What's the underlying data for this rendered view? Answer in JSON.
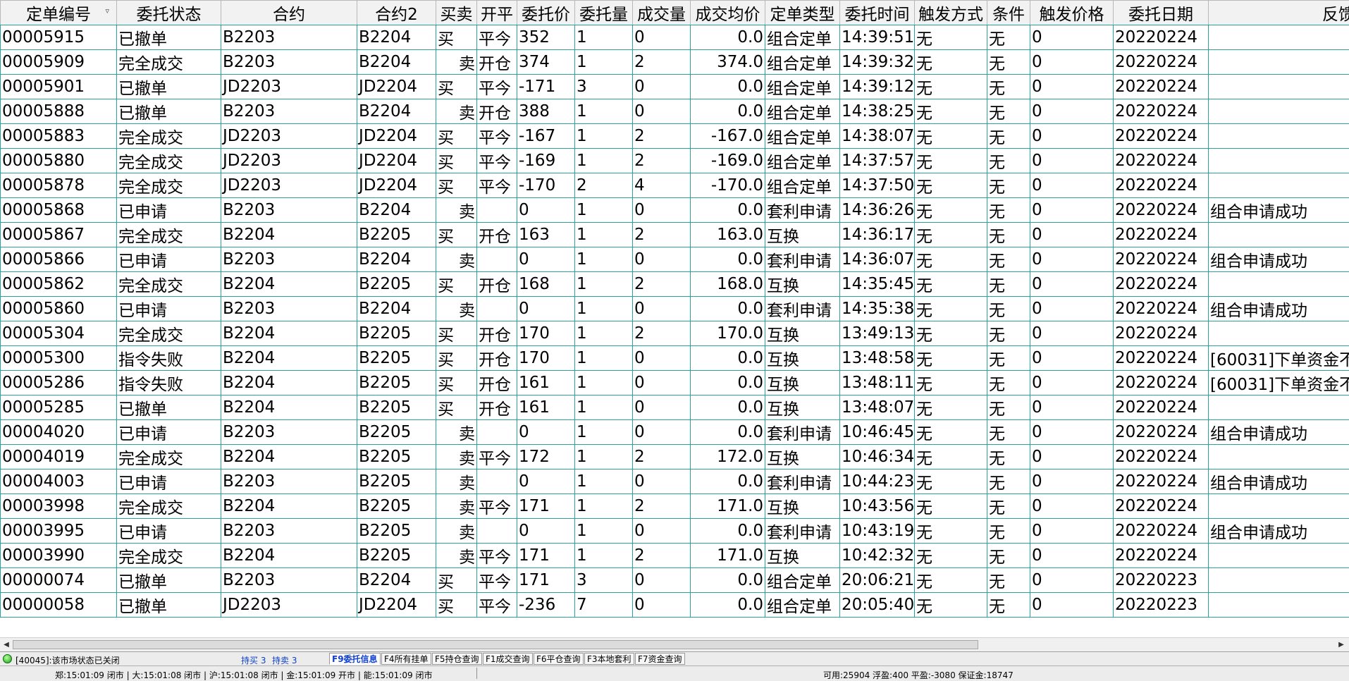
{
  "columns": [
    "定单编号",
    "委托状态",
    "合约",
    "合约2",
    "买卖",
    "开平",
    "委托价",
    "委托量",
    "成交量",
    "成交均价",
    "定单类型",
    "委托时间",
    "触发方式",
    "条件",
    "触发价格",
    "委托日期",
    "反馈"
  ],
  "rows": [
    {
      "id": "00005915",
      "status": "已撤单",
      "status_color": "olive",
      "c1": "B2203",
      "c2": "B2204",
      "bs": "买",
      "bs_color": "red",
      "oc": "平今",
      "oc_color": "green",
      "price": "352",
      "qty": "1",
      "filled": "0",
      "filled_color": "black",
      "avg": "0.0",
      "type": "组合定单",
      "time": "14:39:51",
      "trig": "无",
      "cond": "无",
      "tprice": "0",
      "date": "20220224",
      "fb": ""
    },
    {
      "id": "00005909",
      "status": "完全成交",
      "status_color": "green",
      "c1": "B2203",
      "c2": "B2204",
      "bs": "卖",
      "bs_color": "green",
      "oc": "开仓",
      "oc_color": "red",
      "price": "374",
      "qty": "1",
      "filled": "2",
      "filled_color": "red",
      "avg": "374.0",
      "type": "组合定单",
      "time": "14:39:32",
      "trig": "无",
      "cond": "无",
      "tprice": "0",
      "date": "20220224",
      "fb": ""
    },
    {
      "id": "00005901",
      "status": "已撤单",
      "status_color": "olive",
      "c1": "JD2203",
      "c2": "JD2204",
      "bs": "买",
      "bs_color": "red",
      "oc": "平今",
      "oc_color": "green",
      "price": "-171",
      "qty": "3",
      "filled": "0",
      "filled_color": "black",
      "avg": "0.0",
      "type": "组合定单",
      "time": "14:39:12",
      "trig": "无",
      "cond": "无",
      "tprice": "0",
      "date": "20220224",
      "fb": ""
    },
    {
      "id": "00005888",
      "status": "已撤单",
      "status_color": "olive",
      "c1": "B2203",
      "c2": "B2204",
      "bs": "卖",
      "bs_color": "green",
      "oc": "开仓",
      "oc_color": "red",
      "price": "388",
      "qty": "1",
      "filled": "0",
      "filled_color": "black",
      "avg": "0.0",
      "type": "组合定单",
      "time": "14:38:25",
      "trig": "无",
      "cond": "无",
      "tprice": "0",
      "date": "20220224",
      "fb": ""
    },
    {
      "id": "00005883",
      "status": "完全成交",
      "status_color": "green",
      "c1": "JD2203",
      "c2": "JD2204",
      "bs": "买",
      "bs_color": "red",
      "oc": "平今",
      "oc_color": "green",
      "price": "-167",
      "qty": "1",
      "filled": "2",
      "filled_color": "red",
      "avg": "-167.0",
      "type": "组合定单",
      "time": "14:38:07",
      "trig": "无",
      "cond": "无",
      "tprice": "0",
      "date": "20220224",
      "fb": ""
    },
    {
      "id": "00005880",
      "status": "完全成交",
      "status_color": "green",
      "c1": "JD2203",
      "c2": "JD2204",
      "bs": "买",
      "bs_color": "red",
      "oc": "平今",
      "oc_color": "green",
      "price": "-169",
      "qty": "1",
      "filled": "2",
      "filled_color": "red",
      "avg": "-169.0",
      "type": "组合定单",
      "time": "14:37:57",
      "trig": "无",
      "cond": "无",
      "tprice": "0",
      "date": "20220224",
      "fb": ""
    },
    {
      "id": "00005878",
      "status": "完全成交",
      "status_color": "green",
      "c1": "JD2203",
      "c2": "JD2204",
      "bs": "买",
      "bs_color": "red",
      "oc": "平今",
      "oc_color": "green",
      "price": "-170",
      "qty": "2",
      "filled": "4",
      "filled_color": "red",
      "avg": "-170.0",
      "type": "组合定单",
      "time": "14:37:50",
      "trig": "无",
      "cond": "无",
      "tprice": "0",
      "date": "20220224",
      "fb": ""
    },
    {
      "id": "00005868",
      "status": "已申请",
      "status_color": "black",
      "c1": "B2203",
      "c2": "B2204",
      "bs": "卖",
      "bs_color": "green",
      "oc": "",
      "oc_color": "black",
      "price": "0",
      "qty": "1",
      "filled": "0",
      "filled_color": "black",
      "avg": "0.0",
      "type": "套利申请",
      "time": "14:36:26",
      "trig": "无",
      "cond": "无",
      "tprice": "0",
      "date": "20220224",
      "fb": "组合申请成功"
    },
    {
      "id": "00005867",
      "status": "完全成交",
      "status_color": "green",
      "c1": "B2204",
      "c2": "B2205",
      "bs": "买",
      "bs_color": "red",
      "oc": "开仓",
      "oc_color": "red",
      "price": "163",
      "qty": "1",
      "filled": "2",
      "filled_color": "red",
      "avg": "163.0",
      "type": "互换",
      "time": "14:36:17",
      "trig": "无",
      "cond": "无",
      "tprice": "0",
      "date": "20220224",
      "fb": ""
    },
    {
      "id": "00005866",
      "status": "已申请",
      "status_color": "black",
      "c1": "B2203",
      "c2": "B2204",
      "bs": "卖",
      "bs_color": "green",
      "oc": "",
      "oc_color": "black",
      "price": "0",
      "qty": "1",
      "filled": "0",
      "filled_color": "black",
      "avg": "0.0",
      "type": "套利申请",
      "time": "14:36:07",
      "trig": "无",
      "cond": "无",
      "tprice": "0",
      "date": "20220224",
      "fb": "组合申请成功"
    },
    {
      "id": "00005862",
      "status": "完全成交",
      "status_color": "green",
      "c1": "B2204",
      "c2": "B2205",
      "bs": "买",
      "bs_color": "red",
      "oc": "开仓",
      "oc_color": "red",
      "price": "168",
      "qty": "1",
      "filled": "2",
      "filled_color": "red",
      "avg": "168.0",
      "type": "互换",
      "time": "14:35:45",
      "trig": "无",
      "cond": "无",
      "tprice": "0",
      "date": "20220224",
      "fb": ""
    },
    {
      "id": "00005860",
      "status": "已申请",
      "status_color": "black",
      "c1": "B2203",
      "c2": "B2204",
      "bs": "卖",
      "bs_color": "green",
      "oc": "",
      "oc_color": "black",
      "price": "0",
      "qty": "1",
      "filled": "0",
      "filled_color": "black",
      "avg": "0.0",
      "type": "套利申请",
      "time": "14:35:38",
      "trig": "无",
      "cond": "无",
      "tprice": "0",
      "date": "20220224",
      "fb": "组合申请成功"
    },
    {
      "id": "00005304",
      "status": "完全成交",
      "status_color": "green",
      "c1": "B2204",
      "c2": "B2205",
      "bs": "买",
      "bs_color": "red",
      "oc": "开仓",
      "oc_color": "red",
      "price": "170",
      "qty": "1",
      "filled": "2",
      "filled_color": "red",
      "avg": "170.0",
      "type": "互换",
      "time": "13:49:13",
      "trig": "无",
      "cond": "无",
      "tprice": "0",
      "date": "20220224",
      "fb": ""
    },
    {
      "id": "00005300",
      "status": "指令失败",
      "status_color": "red",
      "c1": "B2204",
      "c2": "B2205",
      "bs": "买",
      "bs_color": "red",
      "oc": "开仓",
      "oc_color": "red",
      "price": "170",
      "qty": "1",
      "filled": "0",
      "filled_color": "black",
      "avg": "0.0",
      "type": "互换",
      "time": "13:48:58",
      "trig": "无",
      "cond": "无",
      "tprice": "0",
      "date": "20220224",
      "fb": "[60031]下单资金不"
    },
    {
      "id": "00005286",
      "status": "指令失败",
      "status_color": "red",
      "c1": "B2204",
      "c2": "B2205",
      "bs": "买",
      "bs_color": "red",
      "oc": "开仓",
      "oc_color": "red",
      "price": "161",
      "qty": "1",
      "filled": "0",
      "filled_color": "black",
      "avg": "0.0",
      "type": "互换",
      "time": "13:48:11",
      "trig": "无",
      "cond": "无",
      "tprice": "0",
      "date": "20220224",
      "fb": "[60031]下单资金不"
    },
    {
      "id": "00005285",
      "status": "已撤单",
      "status_color": "olive",
      "c1": "B2204",
      "c2": "B2205",
      "bs": "买",
      "bs_color": "red",
      "oc": "开仓",
      "oc_color": "red",
      "price": "161",
      "qty": "1",
      "filled": "0",
      "filled_color": "black",
      "avg": "0.0",
      "type": "互换",
      "time": "13:48:07",
      "trig": "无",
      "cond": "无",
      "tprice": "0",
      "date": "20220224",
      "fb": ""
    },
    {
      "id": "00004020",
      "status": "已申请",
      "status_color": "black",
      "c1": "B2203",
      "c2": "B2205",
      "bs": "卖",
      "bs_color": "green",
      "oc": "",
      "oc_color": "black",
      "price": "0",
      "qty": "1",
      "filled": "0",
      "filled_color": "black",
      "avg": "0.0",
      "type": "套利申请",
      "time": "10:46:45",
      "trig": "无",
      "cond": "无",
      "tprice": "0",
      "date": "20220224",
      "fb": "组合申请成功"
    },
    {
      "id": "00004019",
      "status": "完全成交",
      "status_color": "green",
      "c1": "B2204",
      "c2": "B2205",
      "bs": "卖",
      "bs_color": "green",
      "oc": "平今",
      "oc_color": "green",
      "price": "172",
      "qty": "1",
      "filled": "2",
      "filled_color": "red",
      "avg": "172.0",
      "type": "互换",
      "time": "10:46:34",
      "trig": "无",
      "cond": "无",
      "tprice": "0",
      "date": "20220224",
      "fb": ""
    },
    {
      "id": "00004003",
      "status": "已申请",
      "status_color": "black",
      "c1": "B2203",
      "c2": "B2205",
      "bs": "卖",
      "bs_color": "green",
      "oc": "",
      "oc_color": "black",
      "price": "0",
      "qty": "1",
      "filled": "0",
      "filled_color": "black",
      "avg": "0.0",
      "type": "套利申请",
      "time": "10:44:23",
      "trig": "无",
      "cond": "无",
      "tprice": "0",
      "date": "20220224",
      "fb": "组合申请成功"
    },
    {
      "id": "00003998",
      "status": "完全成交",
      "status_color": "green",
      "c1": "B2204",
      "c2": "B2205",
      "bs": "卖",
      "bs_color": "green",
      "oc": "平今",
      "oc_color": "green",
      "price": "171",
      "qty": "1",
      "filled": "2",
      "filled_color": "red",
      "avg": "171.0",
      "type": "互换",
      "time": "10:43:56",
      "trig": "无",
      "cond": "无",
      "tprice": "0",
      "date": "20220224",
      "fb": ""
    },
    {
      "id": "00003995",
      "status": "已申请",
      "status_color": "black",
      "c1": "B2203",
      "c2": "B2205",
      "bs": "卖",
      "bs_color": "green",
      "oc": "",
      "oc_color": "black",
      "price": "0",
      "qty": "1",
      "filled": "0",
      "filled_color": "black",
      "avg": "0.0",
      "type": "套利申请",
      "time": "10:43:19",
      "trig": "无",
      "cond": "无",
      "tprice": "0",
      "date": "20220224",
      "fb": "组合申请成功"
    },
    {
      "id": "00003990",
      "status": "完全成交",
      "status_color": "green",
      "c1": "B2204",
      "c2": "B2205",
      "bs": "卖",
      "bs_color": "green",
      "oc": "平今",
      "oc_color": "green",
      "price": "171",
      "qty": "1",
      "filled": "2",
      "filled_color": "red",
      "avg": "171.0",
      "type": "互换",
      "time": "10:42:32",
      "trig": "无",
      "cond": "无",
      "tprice": "0",
      "date": "20220224",
      "fb": ""
    },
    {
      "id": "00000074",
      "status": "已撤单",
      "status_color": "olive",
      "c1": "B2203",
      "c2": "B2204",
      "bs": "买",
      "bs_color": "red",
      "oc": "平今",
      "oc_color": "green",
      "price": "171",
      "qty": "3",
      "filled": "0",
      "filled_color": "black",
      "avg": "0.0",
      "type": "组合定单",
      "time": "20:06:21",
      "trig": "无",
      "cond": "无",
      "tprice": "0",
      "date": "20220223",
      "fb": ""
    },
    {
      "id": "00000058",
      "status": "已撤单",
      "status_color": "olive",
      "c1": "JD2203",
      "c2": "JD2204",
      "bs": "买",
      "bs_color": "red",
      "oc": "平今",
      "oc_color": "green",
      "price": "-236",
      "qty": "7",
      "filled": "0",
      "filled_color": "black",
      "avg": "0.0",
      "type": "组合定单",
      "time": "20:05:40",
      "trig": "无",
      "cond": "无",
      "tprice": "0",
      "date": "20220223",
      "fb": ""
    }
  ],
  "statusbar": {
    "message": "[40045]:该市场状态已关闭",
    "buy_positions": "持买 3",
    "sell_positions": "持卖 3",
    "tabs": [
      "F9委托信息",
      "F4所有挂单",
      "F5持仓查询",
      "F1成交查询",
      "F6平仓查询",
      "F3本地套利",
      "F7资金查询"
    ],
    "active_tab": "F9委托信息",
    "market_times": "郑:15:01:09 闭市 | 大:15:01:08 闭市 | 沪:15:01:08 闭市 | 金:15:01:09 开市 | 能:15:01:09 闭市",
    "account_info": "可用:25904 浮盈:400 平盈:-3080 保证金:18747"
  },
  "colors": {
    "green": "#008000",
    "olive": "#8a8a00",
    "red": "#ff0000",
    "grid": "#2aa0a0",
    "tab_active": "#1040d0"
  },
  "icons": [
    "sort-desc-icon",
    "scroll-left-icon",
    "scroll-right-icon",
    "connection-status-icon"
  ]
}
